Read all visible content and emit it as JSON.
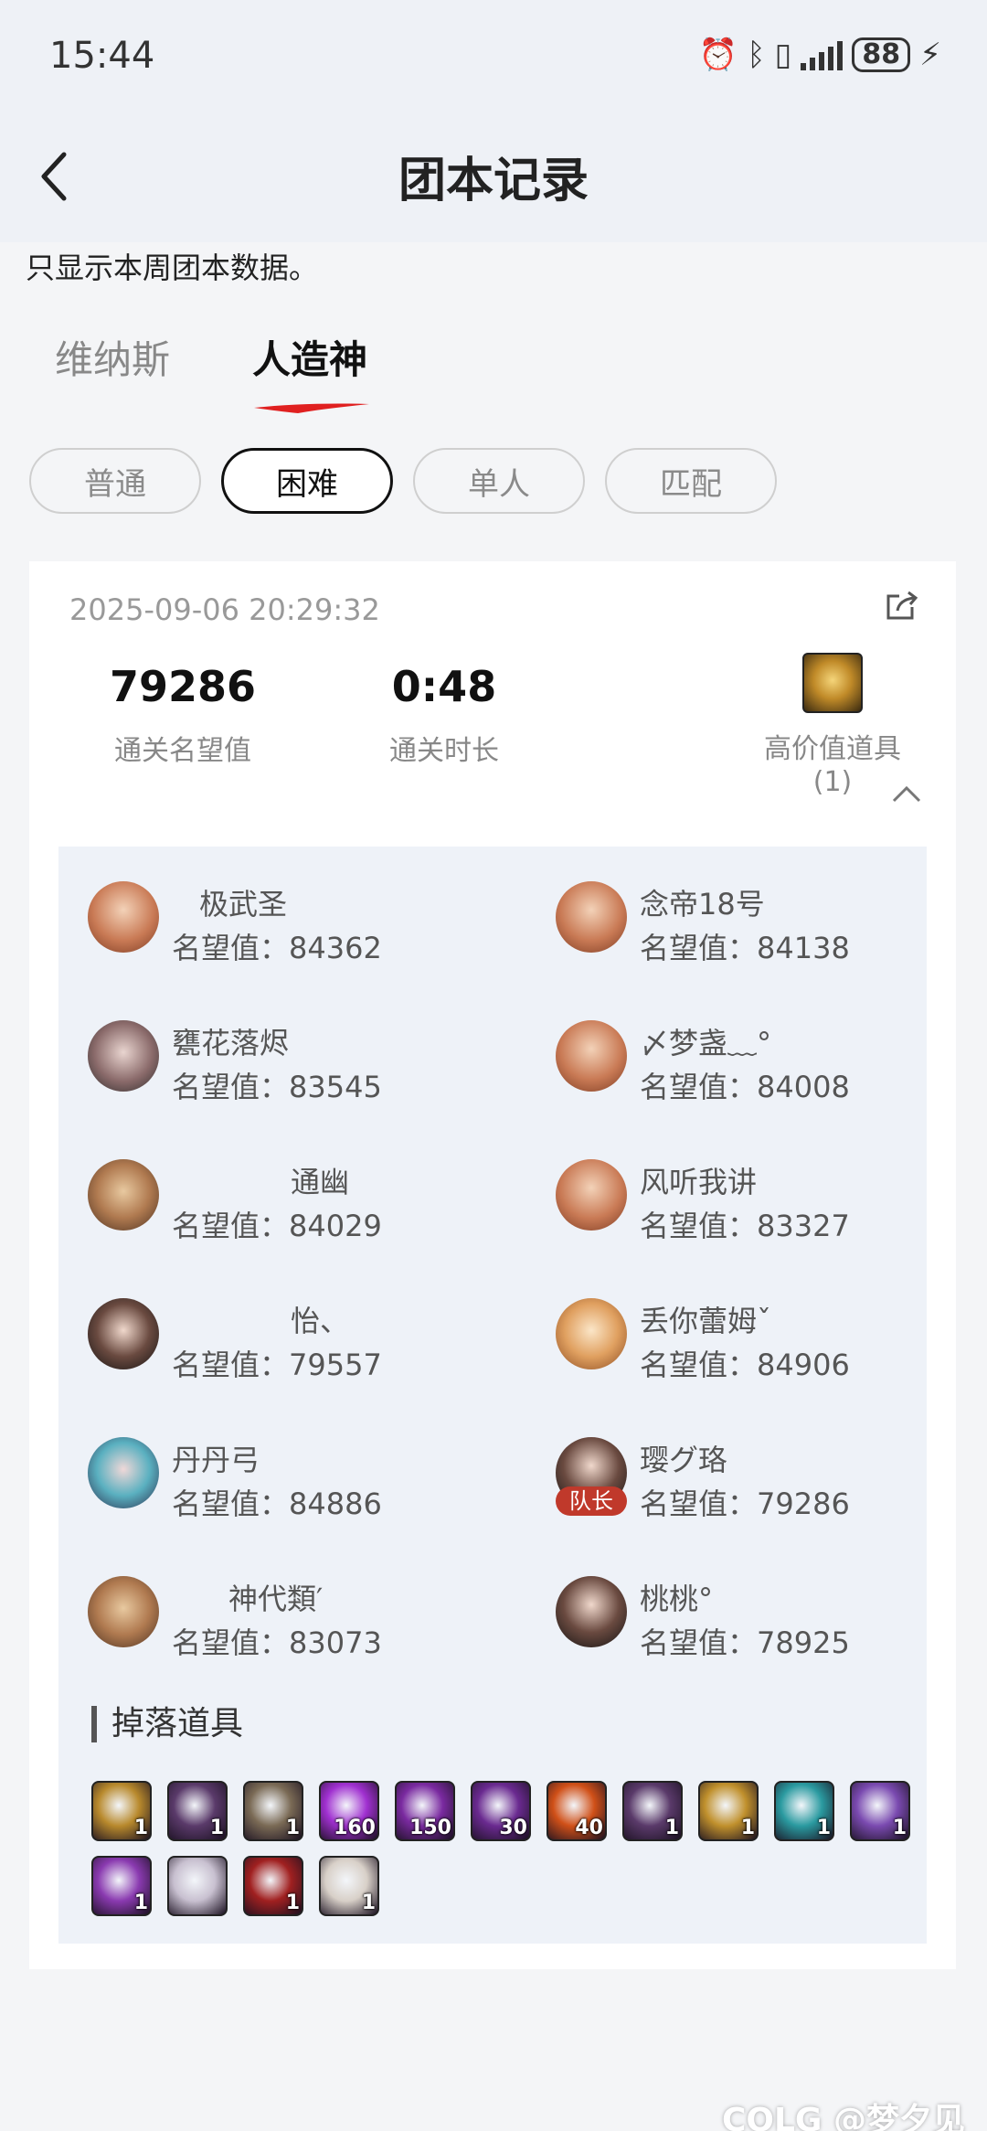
{
  "status_bar": {
    "time": "15:44",
    "battery": "88"
  },
  "header": {
    "title": "团本记录"
  },
  "notice": "只显示本周团本数据。",
  "tabs": [
    {
      "label": "维纳斯",
      "active": false
    },
    {
      "label": "人造神",
      "active": true
    }
  ],
  "filters": [
    {
      "label": "普通",
      "active": false
    },
    {
      "label": "困难",
      "active": true
    },
    {
      "label": "单人",
      "active": false
    },
    {
      "label": "匹配",
      "active": false
    }
  ],
  "record": {
    "time": "2025-09-06 20:29:32",
    "stats": [
      {
        "value": "79286",
        "label": "通关名望值"
      },
      {
        "value": "0:48",
        "label": "通关时长"
      }
    ],
    "high_value_label": "高价值道具(1)",
    "members": [
      {
        "name": "极武圣",
        "reputation": "名望值：84362",
        "leader": false
      },
      {
        "name": "念帝18号",
        "reputation": "名望值：84138",
        "leader": false
      },
      {
        "name": "甕花落烬",
        "reputation": "名望值：83545",
        "leader": false
      },
      {
        "name": "〆梦盏﹏°",
        "reputation": "名望值：84008",
        "leader": false
      },
      {
        "name": "通幽",
        "reputation": "名望值：84029",
        "leader": false
      },
      {
        "name": "风听我讲",
        "reputation": "名望值：83327",
        "leader": false
      },
      {
        "name": "怡、",
        "reputation": "名望值：79557",
        "leader": false
      },
      {
        "name": "丢你蕾姆ˇ",
        "reputation": "名望值：84906",
        "leader": false
      },
      {
        "name": "丹丹弓",
        "reputation": "名望值：84886",
        "leader": false
      },
      {
        "name": "璎グ珞",
        "reputation": "名望值：79286",
        "leader": true,
        "badge": "队长"
      },
      {
        "name": "神代類′",
        "reputation": "名望值：83073",
        "leader": false
      },
      {
        "name": "桃桃°",
        "reputation": "名望值：78925",
        "leader": false
      }
    ],
    "drops_title": "掉落道具",
    "drops": [
      {
        "count": "1",
        "color": "#b8892c"
      },
      {
        "count": "1",
        "color": "#5a3a6a"
      },
      {
        "count": "1",
        "color": "#7a6a55"
      },
      {
        "count": "160",
        "color": "#a030d0"
      },
      {
        "count": "150",
        "color": "#7a2aa0"
      },
      {
        "count": "30",
        "color": "#6a2a90"
      },
      {
        "count": "40",
        "color": "#d05018"
      },
      {
        "count": "1",
        "color": "#5a3a6a"
      },
      {
        "count": "1",
        "color": "#c0902c"
      },
      {
        "count": "1",
        "color": "#2a9aa0"
      },
      {
        "count": "1",
        "color": "#7a4ab0"
      },
      {
        "count": "1",
        "color": "#8a3ab0"
      },
      {
        "count": "",
        "color": "#c8c0d0"
      },
      {
        "count": "1",
        "color": "#a02020"
      },
      {
        "count": "1",
        "color": "#d8d0c8"
      }
    ]
  },
  "watermark": "COLG @梦夕见"
}
